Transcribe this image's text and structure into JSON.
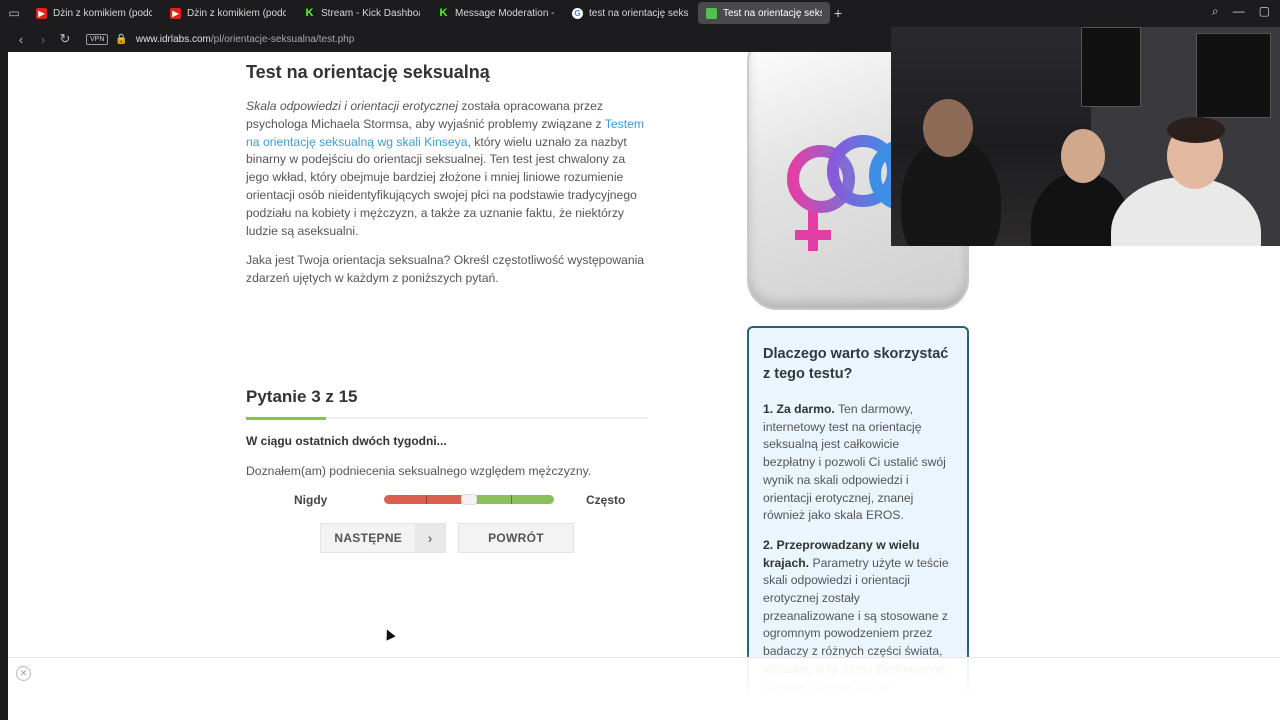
{
  "browser": {
    "tabs": [
      {
        "label": "Dżin z komikiem (podcast",
        "icon": "youtube-icon",
        "active": false
      },
      {
        "label": "Dżin z komikiem (podcast",
        "icon": "youtube-icon",
        "active": false
      },
      {
        "label": "Stream - Kick Dashboard",
        "icon": "kick-icon",
        "active": false
      },
      {
        "label": "Message Moderation - K",
        "icon": "kick-icon",
        "active": false
      },
      {
        "label": "test na orientację seksual",
        "icon": "google-icon",
        "active": false
      },
      {
        "label": "Test na orientację seksual",
        "icon": "idrlabs-icon",
        "active": true
      }
    ],
    "vpn_label": "VPN",
    "url_host": "www.idrlabs.com",
    "url_path": "/pl/orientacje-seksualna/test.php"
  },
  "article": {
    "title": "Test na orientację seksualną",
    "intro_italic": "Skala odpowiedzi i orientacji erotycznej",
    "intro_part1": " została opracowana przez psychologa Michaela Stormsa, aby wyjaśnić problemy związane z ",
    "intro_link": "Testem na orientację seksualną wg skali Kinseya",
    "intro_part2": ", który wielu uznało za nazbyt binarny w podejściu do orientacji seksualnej. Ten test jest chwalony za jego wkład, który obejmuje bardziej złożone i mniej liniowe rozumienie orientacji osób nieidentyfikujących swojej płci na podstawie tradycyjnego podziału na kobiety i mężczyzn, a także za uznanie faktu, że niektórzy ludzie są aseksualni.",
    "question_intro": "Jaka jest Twoja orientacja seksualna? Określ częstotliwość występowania zdarzeń ujętych w każdym z poniższych pytań."
  },
  "quiz": {
    "heading": "Pytanie 3 z 15",
    "progress": 0.2,
    "prompt": "W ciągu ostatnich dwóch tygodni...",
    "question": "Doznałem(am) podniecenia seksualnego względem mężczyzny.",
    "scale_min_label": "Nigdy",
    "scale_max_label": "Często",
    "slider_value": 0.5,
    "next_label": "NASTĘPNE",
    "back_label": "POWRÓT"
  },
  "sidebar": {
    "box_title": "Dlaczego warto skorzystać z tego testu?",
    "point1_bold": "1. Za darmo.",
    "point1_text": " Ten darmowy, internetowy test na orientację seksualną jest całkowicie bezpłatny i pozwoli Ci ustalić swój wynik na skali odpowiedzi i orientacji erotycznej, znanej również jako skala EROS.",
    "point2_bold": "2. Przeprowadzany w wielu krajach.",
    "point2_text": " Parametry użyte w teście skali odpowiedzi i orientacji erotycznej zostały przeanalizowane i są stosowane z ogromnym powodzeniem przez badaczy z różnych części świata, wliczając w to Stany Zjednoczone, Kanadę i szereg krajów europejskich."
  },
  "colors": {
    "link": "#3a9fd6",
    "progress": "#8bc34a",
    "slider_red": "#d9604e",
    "slider_green": "#8bbf5a",
    "box_border": "#2b5f75",
    "box_bg": "#eaf5fd"
  }
}
